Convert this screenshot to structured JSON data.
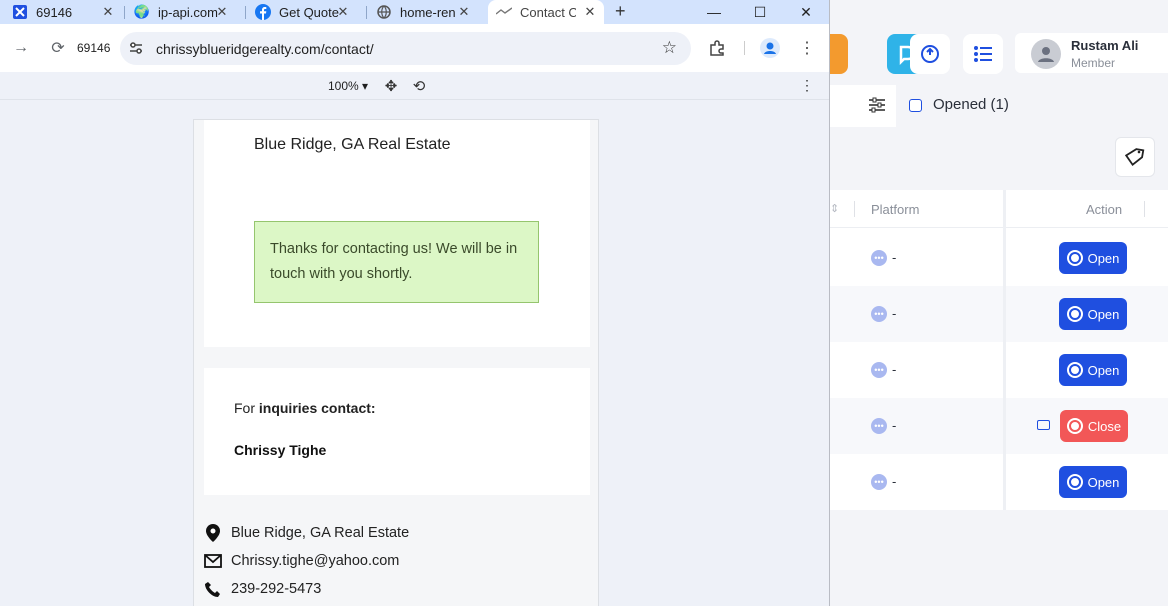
{
  "browser": {
    "tabs": [
      {
        "title": "69146",
        "icon": "app-logo-icon"
      },
      {
        "title": "ip-api.com",
        "icon": "globe-icon"
      },
      {
        "title": "Get Quote",
        "icon": "facebook-icon"
      },
      {
        "title": "home-ren",
        "icon": "globe-icon"
      },
      {
        "title": "Contact C",
        "icon": "site-favicon-icon",
        "active": true
      }
    ],
    "tab_count_badge": "69146",
    "url": "chrissyblueridgerealty.com/contact/",
    "zoom_level": "100%"
  },
  "page": {
    "brand": "Blue Ridge, GA Real Estate",
    "notice": "Thanks for contacting us! We will be in touch with you shortly.",
    "inquiries_prefix": "For",
    "inquiries_bold": "inquiries contact:",
    "contact_name": "Chrissy Tighe",
    "address": "Blue Ridge, GA Real Estate",
    "email": "Chrissy.tighe@yahoo.com",
    "phone": "239-292-5473"
  },
  "bg_app": {
    "user": {
      "name": "Rustam Ali",
      "role": "Member"
    },
    "filter": {
      "opened_label": "Opened (1)"
    },
    "table": {
      "headers": {
        "platform": "Platform",
        "action": "Action"
      },
      "rows": [
        {
          "platform": "-",
          "action": "Open"
        },
        {
          "platform": "-",
          "action": "Open"
        },
        {
          "platform": "-",
          "action": "Open"
        },
        {
          "platform": "-",
          "action": "Close"
        },
        {
          "platform": "-",
          "action": "Open"
        }
      ]
    },
    "colors": {
      "accent": "#1f4fe0",
      "danger": "#f25757"
    }
  }
}
